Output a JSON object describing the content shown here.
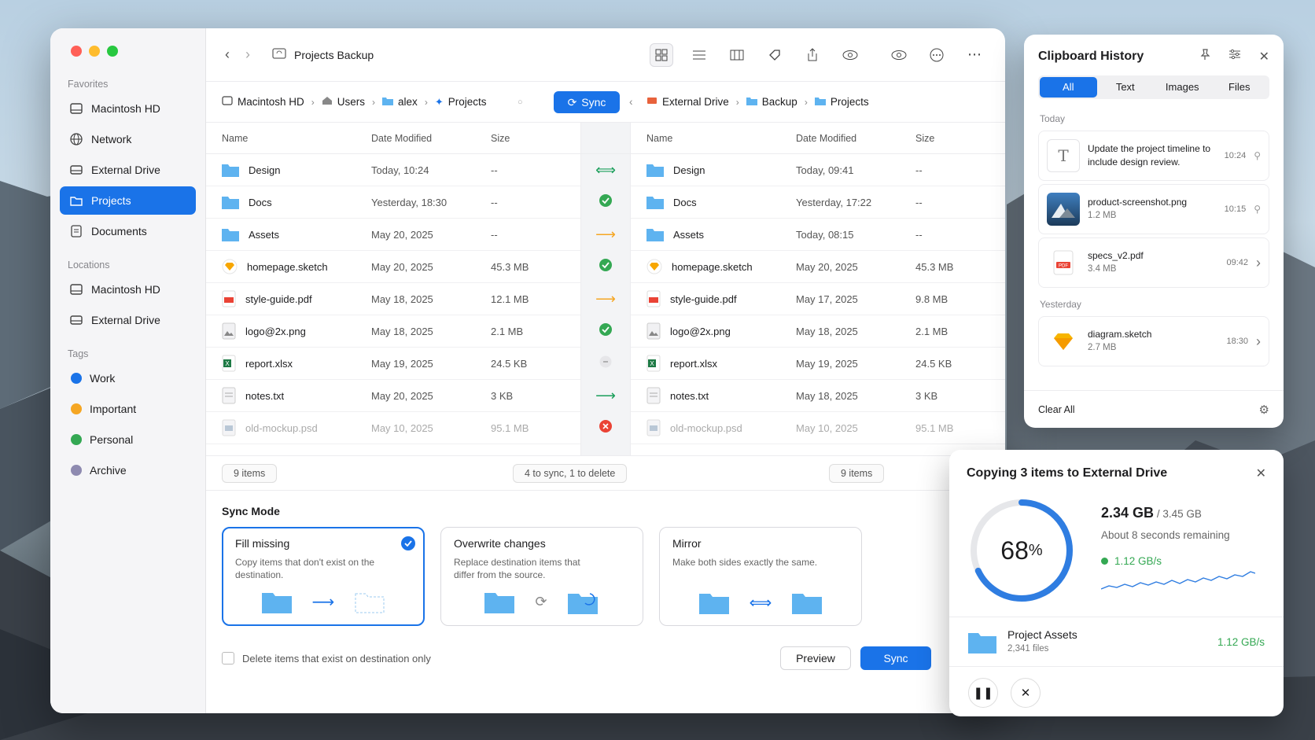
{
  "window": {
    "title": "Projects Backup"
  },
  "sidebar": {
    "favorites_h": "Favorites",
    "favorites": [
      "Macintosh HD",
      "Network",
      "External Drive",
      "Projects",
      "Documents"
    ],
    "locations_h": "Locations",
    "locations": [
      "Macintosh HD",
      "External Drive"
    ],
    "tags_h": "Tags",
    "tags": [
      {
        "label": "Work",
        "color": "#1a73e8"
      },
      {
        "label": "Important",
        "color": "#f5a623"
      },
      {
        "label": "Personal",
        "color": "#34a853"
      },
      {
        "label": "Archive",
        "color": "#8e8ab0"
      }
    ]
  },
  "path": {
    "left": [
      "Macintosh HD",
      "Users",
      "alex",
      "Projects"
    ],
    "sync_label": "Sync",
    "right": [
      "External Drive",
      "Backup",
      "Projects"
    ]
  },
  "columns": {
    "name": "Name",
    "date": "Date Modified",
    "size": "Size"
  },
  "left_files": [
    {
      "name": "Design",
      "date": "Today, 10:24",
      "size": "--",
      "type": "folder"
    },
    {
      "name": "Docs",
      "date": "Yesterday, 18:30",
      "size": "--",
      "type": "folder"
    },
    {
      "name": "Assets",
      "date": "May 20, 2025",
      "size": "--",
      "type": "folder"
    },
    {
      "name": "homepage.sketch",
      "date": "May 20, 2025",
      "size": "45.3 MB",
      "type": "sketch"
    },
    {
      "name": "style-guide.pdf",
      "date": "May 18, 2025",
      "size": "12.1 MB",
      "type": "pdf"
    },
    {
      "name": "logo@2x.png",
      "date": "May 18, 2025",
      "size": "2.1 MB",
      "type": "png"
    },
    {
      "name": "report.xlsx",
      "date": "May 19, 2025",
      "size": "24.5 KB",
      "type": "xlsx"
    },
    {
      "name": "notes.txt",
      "date": "May 20, 2025",
      "size": "3 KB",
      "type": "txt"
    },
    {
      "name": "old-mockup.psd",
      "date": "May 10, 2025",
      "size": "95.1 MB",
      "type": "psd"
    }
  ],
  "right_files": [
    {
      "name": "Design",
      "date": "Today, 09:41",
      "size": "--",
      "type": "folder"
    },
    {
      "name": "Docs",
      "date": "Yesterday, 17:22",
      "size": "--",
      "type": "folder"
    },
    {
      "name": "Assets",
      "date": "Today, 08:15",
      "size": "--",
      "type": "folder"
    },
    {
      "name": "homepage.sketch",
      "date": "May 20, 2025",
      "size": "45.3 MB",
      "type": "sketch"
    },
    {
      "name": "style-guide.pdf",
      "date": "May 17, 2025",
      "size": "9.8 MB",
      "type": "pdf"
    },
    {
      "name": "logo@2x.png",
      "date": "May 18, 2025",
      "size": "2.1 MB",
      "type": "png"
    },
    {
      "name": "report.xlsx",
      "date": "May 19, 2025",
      "size": "24.5 KB",
      "type": "xlsx"
    },
    {
      "name": "notes.txt",
      "date": "May 18, 2025",
      "size": "3 KB",
      "type": "txt"
    },
    {
      "name": "old-mockup.psd",
      "date": "May 10, 2025",
      "size": "95.1 MB",
      "type": "psd"
    }
  ],
  "sync_status": [
    "both",
    "same",
    "right",
    "same",
    "right",
    "same",
    "skip",
    "right-green",
    "delete"
  ],
  "status": {
    "left": "9 items",
    "mid": "4 to sync, 1 to delete",
    "right": "9 items"
  },
  "sync_mode": {
    "title": "Sync Mode",
    "cards": [
      {
        "title": "Fill missing",
        "desc": "Copy items that don't exist on the destination."
      },
      {
        "title": "Overwrite changes",
        "desc": "Replace destination items that differ from the source."
      },
      {
        "title": "Mirror",
        "desc": "Make both sides exactly the same."
      }
    ],
    "delete_opt": "Delete items that exist on destination only",
    "preview": "Preview",
    "sync": "Sync"
  },
  "clipboard": {
    "title": "Clipboard History",
    "tabs": [
      "All",
      "Text",
      "Images",
      "Files"
    ],
    "today": "Today",
    "yesterday": "Yesterday",
    "items": [
      {
        "title": "Update the project timeline to include design review.",
        "sub": "",
        "time": "10:24"
      },
      {
        "title": "product-screenshot.png",
        "sub": "1.2 MB",
        "time": "10:15"
      },
      {
        "title": "specs_v2.pdf",
        "sub": "3.4 MB",
        "time": "09:42"
      },
      {
        "title": "diagram.sketch",
        "sub": "2.7 MB",
        "time": "18:30"
      }
    ],
    "clear": "Clear All"
  },
  "copy": {
    "title": "Copying 3 items to External Drive",
    "percent": "68",
    "percent_sign": "%",
    "progress": 0.68,
    "done": "2.34 GB",
    "total": "/ 3.45 GB",
    "remaining": "About 8 seconds remaining",
    "speed": "1.12 GB/s",
    "project": "Project Assets",
    "files": "2,341 files",
    "project_speed": "1.12 GB/s"
  },
  "colors": {
    "accent": "#1a73e8",
    "green": "#34a853",
    "orange": "#f5a623",
    "red": "#ea4335"
  }
}
